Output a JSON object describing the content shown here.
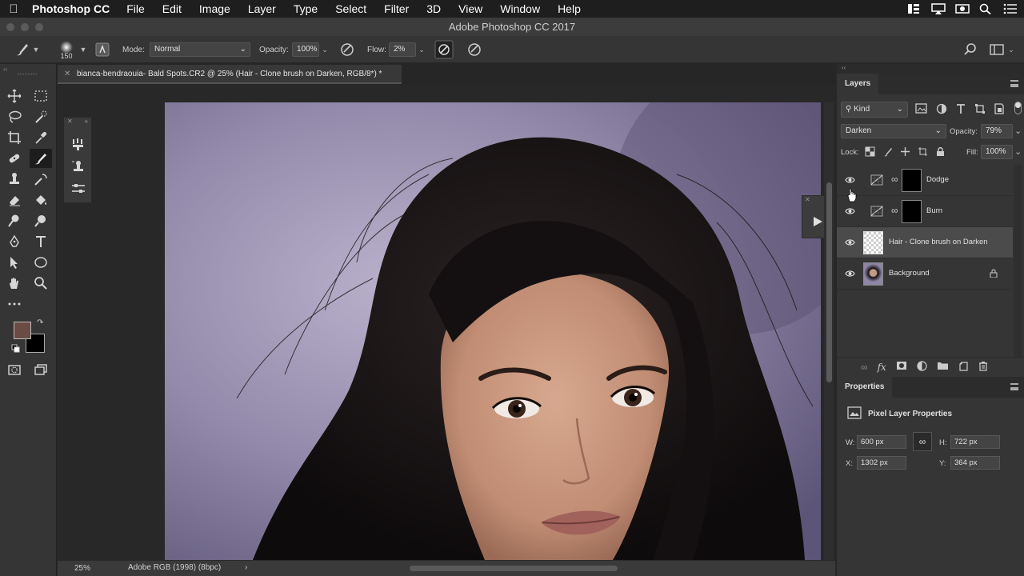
{
  "menubar": {
    "app_name": "Photoshop CC",
    "items": [
      "File",
      "Edit",
      "Image",
      "Layer",
      "Type",
      "Select",
      "Filter",
      "3D",
      "View",
      "Window",
      "Help"
    ]
  },
  "window_title": "Adobe Photoshop CC 2017",
  "options": {
    "brush_size": "150",
    "mode_label": "Mode:",
    "mode_value": "Normal",
    "opacity_label": "Opacity:",
    "opacity_value": "100%",
    "flow_label": "Flow:",
    "flow_value": "2%"
  },
  "document_tab": "bianca-bendraouia- Bald Spots.CR2 @ 25% (Hair - Clone brush on Darken, RGB/8*) *",
  "status": {
    "zoom": "25%",
    "profile": "Adobe RGB (1998) (8bpc)",
    "arrow": "›"
  },
  "layers_panel": {
    "title": "Layers",
    "filter_kind": "Kind",
    "blend_mode": "Darken",
    "opacity_label": "Opacity:",
    "opacity_value": "79%",
    "lock_label": "Lock:",
    "fill_label": "Fill:",
    "fill_value": "100%",
    "layers": [
      {
        "name": "Dodge"
      },
      {
        "name": "Burn"
      },
      {
        "name": "Hair - Clone brush on Darken"
      },
      {
        "name": "Background"
      }
    ]
  },
  "properties_panel": {
    "title": "Properties",
    "subtitle": "Pixel Layer Properties",
    "w_label": "W:",
    "w_value": "600 px",
    "h_label": "H:",
    "h_value": "722 px",
    "x_label": "X:",
    "x_value": "1302 px",
    "y_label": "Y:",
    "y_value": "364 px"
  },
  "colors": {
    "foreground": "#6b4c44",
    "background": "#000000",
    "panel": "#353535",
    "canvas_bg": "#282828"
  }
}
